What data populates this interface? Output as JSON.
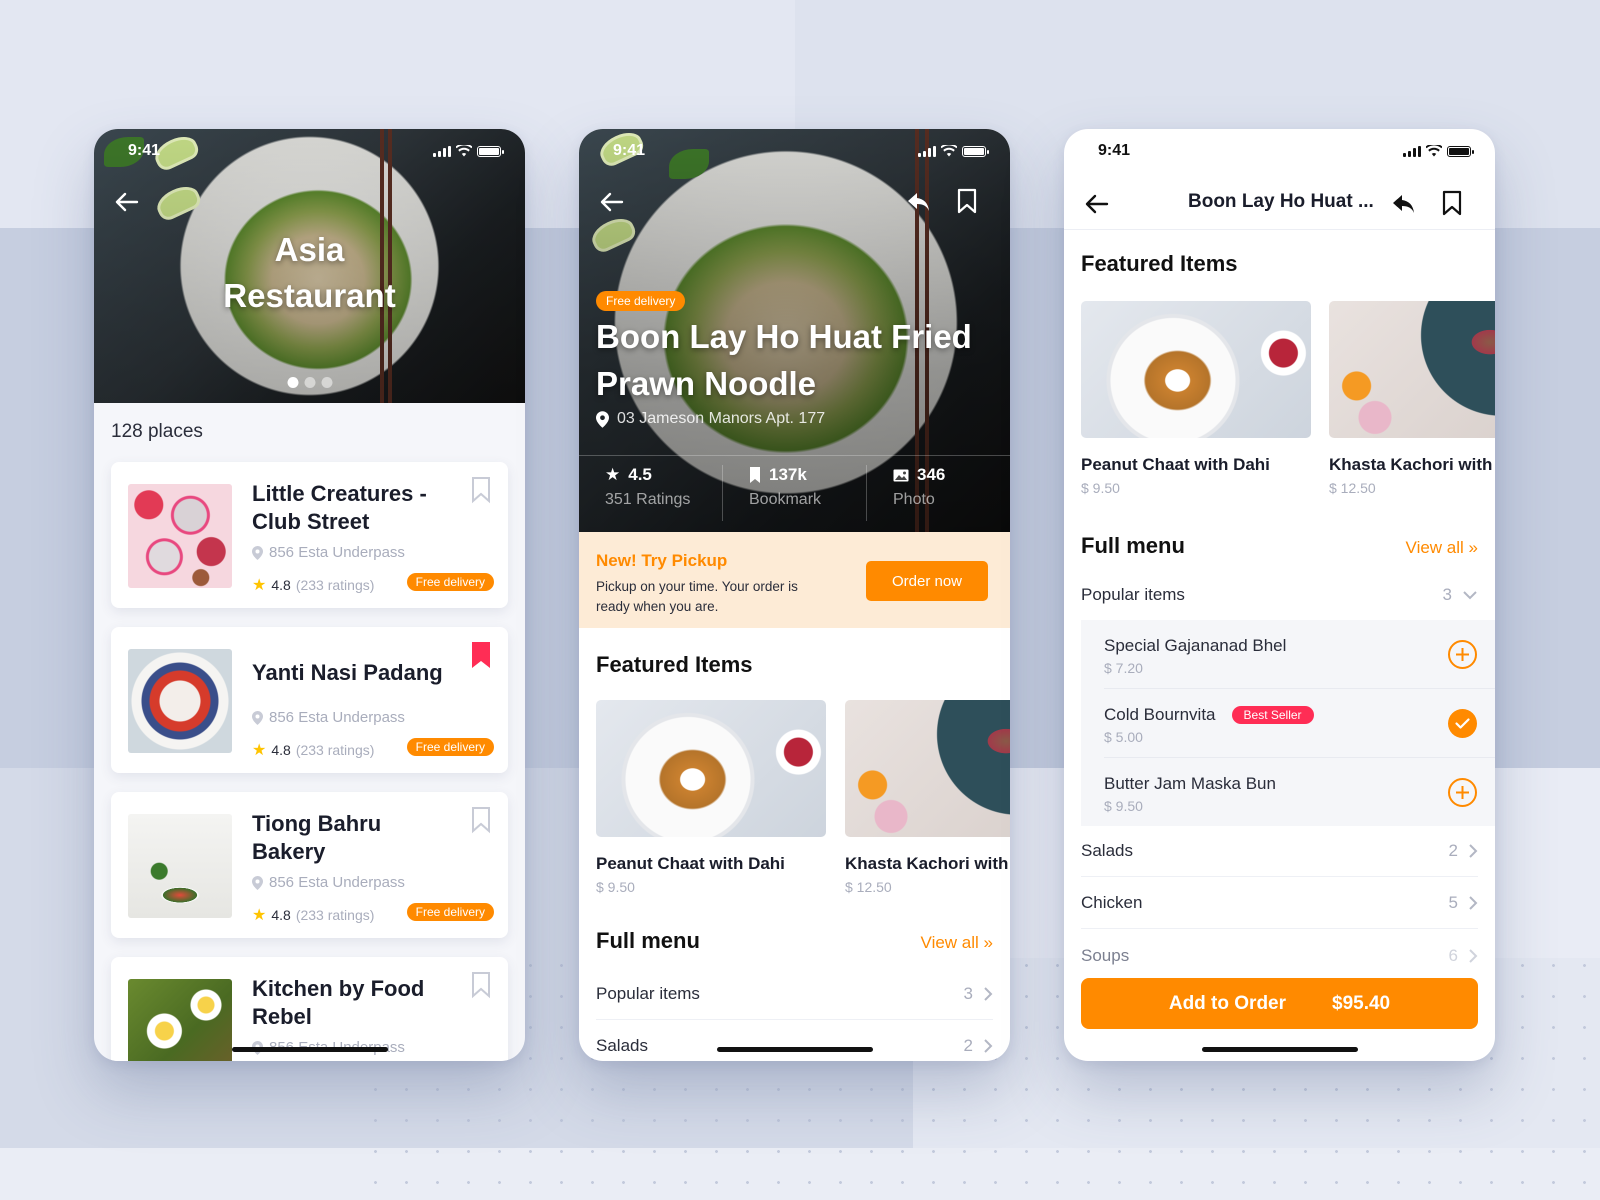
{
  "status_bar": {
    "time": "9:41"
  },
  "screen1": {
    "hero_title_line1": "Asia",
    "hero_title_line2": "Restaurant",
    "carousel": {
      "total_pages": 3,
      "active_page": 1
    },
    "places_count": "128 places",
    "restaurants": [
      {
        "name": "Little Creatures - Club Street",
        "address": "856 Esta Underpass",
        "rating": "4.8",
        "ratings_count": "(233 ratings)",
        "badge": "Free delivery",
        "bookmarked": false
      },
      {
        "name": "Yanti Nasi Padang",
        "address": "856 Esta Underpass",
        "rating": "4.8",
        "ratings_count": "(233 ratings)",
        "badge": "Free delivery",
        "bookmarked": true
      },
      {
        "name": "Tiong Bahru Bakery",
        "address": "856 Esta Underpass",
        "rating": "4.8",
        "ratings_count": "(233 ratings)",
        "badge": "Free delivery",
        "bookmarked": false
      },
      {
        "name": "Kitchen by Food Rebel",
        "address": "856 Esta Underpass",
        "rating": "",
        "ratings_count": "",
        "badge": "",
        "bookmarked": false
      }
    ]
  },
  "screen2": {
    "badge": "Free delivery",
    "title": "Boon Lay Ho Huat Fried Prawn Noodle",
    "address": "03 Jameson Manors Apt. 177",
    "stats": [
      {
        "icon": "star-icon",
        "value": "4.5",
        "label": "351 Ratings"
      },
      {
        "icon": "bookmark-icon",
        "value": "137k",
        "label": "Bookmark"
      },
      {
        "icon": "photo-icon",
        "value": "346",
        "label": "Photo"
      }
    ],
    "promo": {
      "title": "New! Try Pickup",
      "description": "Pickup on your time. Your order is ready when you are.",
      "button": "Order now"
    },
    "featured_title": "Featured Items",
    "featured": [
      {
        "name": "Peanut Chaat with Dahi",
        "price": "$ 9.50"
      },
      {
        "name": "Khasta Kachori with",
        "price": "$ 12.50"
      }
    ],
    "full_menu_title": "Full menu",
    "view_all": "View all »",
    "menu": [
      {
        "name": "Popular items",
        "count": "3"
      },
      {
        "name": "Salads",
        "count": "2"
      }
    ]
  },
  "screen3": {
    "nav_title": "Boon Lay Ho Huat ...",
    "featured_title": "Featured Items",
    "featured": [
      {
        "name": "Peanut Chaat with Dahi",
        "price": "$ 9.50"
      },
      {
        "name": "Khasta Kachori with",
        "price": "$ 12.50"
      }
    ],
    "full_menu_title": "Full menu",
    "view_all": "View all »",
    "popular": {
      "name": "Popular items",
      "count": "3",
      "expanded": true
    },
    "popular_items": [
      {
        "name": "Special Gajananad Bhel",
        "price": "$ 7.20",
        "badge": "",
        "added": false
      },
      {
        "name": "Cold Bournvita",
        "price": "$ 5.00",
        "badge": "Best Seller",
        "added": true
      },
      {
        "name": "Butter Jam Maska Bun",
        "price": "$ 9.50",
        "badge": "",
        "added": false
      }
    ],
    "menu": [
      {
        "name": "Salads",
        "count": "2"
      },
      {
        "name": "Chicken",
        "count": "5"
      },
      {
        "name": "Soups",
        "count": "6"
      }
    ],
    "add_to_order": {
      "label": "Add to Order",
      "total": "$95.40"
    }
  },
  "colors": {
    "accent": "#ff8a00",
    "bookmark_active": "#ff2d55",
    "best_seller": "#ff2d55",
    "promo_bg": "#fdebd6"
  }
}
